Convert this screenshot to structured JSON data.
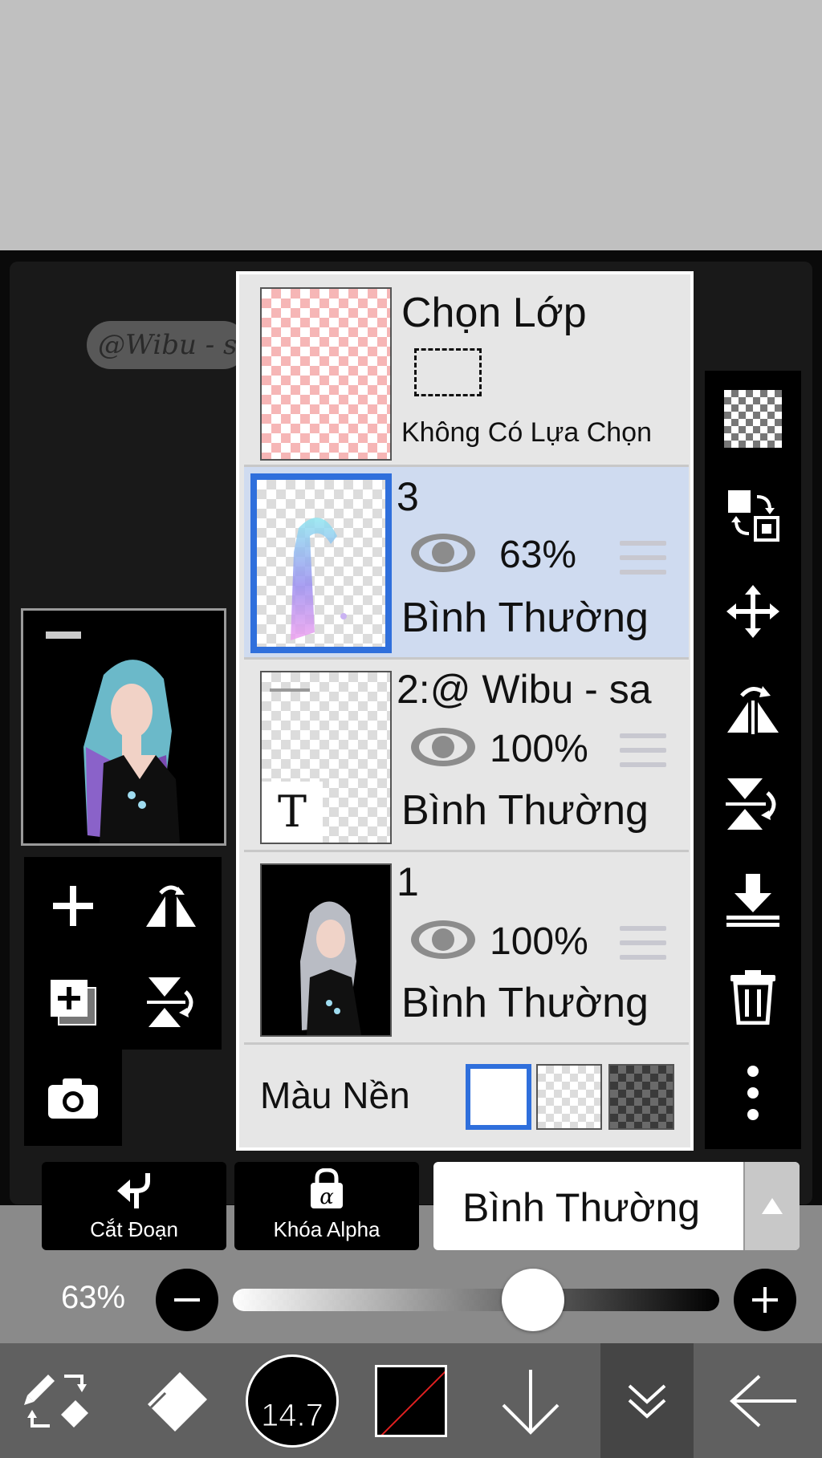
{
  "layers_panel": {
    "selection_layer": {
      "title": "Chọn Lớp",
      "status": "Không Có Lựa Chọn"
    },
    "layers": [
      {
        "name": "3",
        "opacity": "63%",
        "blend_mode": "Bình Thường",
        "selected": true
      },
      {
        "name": "2:@ Wibu - sa",
        "opacity": "100%",
        "blend_mode": "Bình Thường",
        "selected": false,
        "thumb_badge": "T"
      },
      {
        "name": "1",
        "opacity": "100%",
        "blend_mode": "Bình Thường",
        "selected": false
      }
    ],
    "background": {
      "label": "Màu Nền",
      "options": [
        "white",
        "transparent",
        "dark-checker"
      ],
      "selected": "white"
    }
  },
  "watermark_text": "@Wibu - sa",
  "actions": {
    "clip_label": "Cắt Đoạn",
    "alpha_lock_label": "Khóa Alpha",
    "blend_mode_value": "Bình Thường"
  },
  "opacity_control": {
    "label": "63%",
    "value": 0.63
  },
  "bottom_toolbar": {
    "brush_size": "14.7"
  },
  "colors": {
    "accent": "#2f6fdc",
    "selected_row": "#cfdbf0",
    "panel_bg": "#e6e6e6"
  }
}
